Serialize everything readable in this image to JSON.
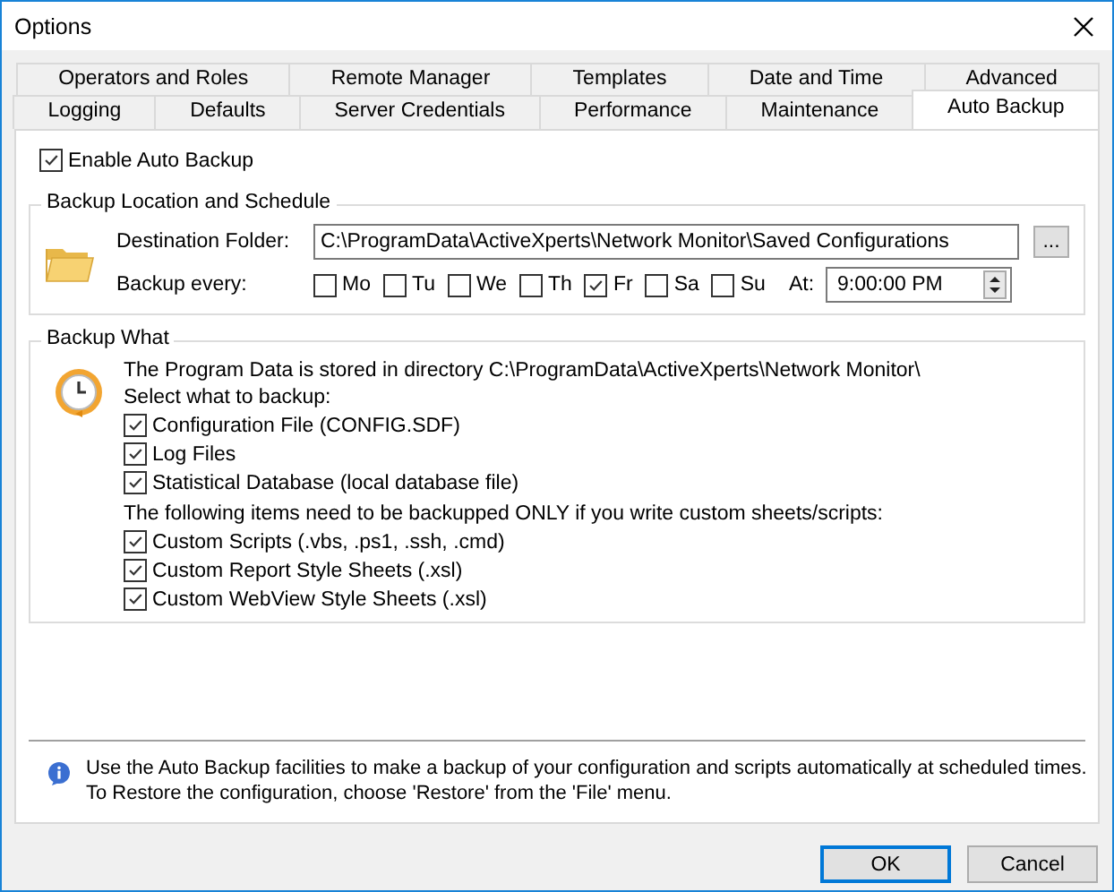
{
  "window": {
    "title": "Options"
  },
  "tab_rows": [
    [
      {
        "label": "Operators and Roles",
        "selected": false
      },
      {
        "label": "Remote Manager",
        "selected": false
      },
      {
        "label": "Templates",
        "selected": false
      },
      {
        "label": "Date and Time",
        "selected": false
      },
      {
        "label": "Advanced",
        "selected": false
      }
    ],
    [
      {
        "label": "Logging",
        "selected": false
      },
      {
        "label": "Defaults",
        "selected": false
      },
      {
        "label": "Server Credentials",
        "selected": false
      },
      {
        "label": "Performance",
        "selected": false
      },
      {
        "label": "Maintenance",
        "selected": false
      },
      {
        "label": "Auto Backup",
        "selected": true
      }
    ]
  ],
  "enable_auto_backup": {
    "label": "Enable Auto Backup",
    "checked": true
  },
  "location_group": {
    "title": "Backup Location and Schedule",
    "folder_label": "Destination Folder:",
    "folder_value": "C:\\ProgramData\\ActiveXperts\\Network Monitor\\Saved Configurations",
    "browse_button": "...",
    "every_label": "Backup every:",
    "days": [
      {
        "label": "Mo",
        "checked": false
      },
      {
        "label": "Tu",
        "checked": false
      },
      {
        "label": "We",
        "checked": false
      },
      {
        "label": "Th",
        "checked": false
      },
      {
        "label": "Fr",
        "checked": true
      },
      {
        "label": "Sa",
        "checked": false
      },
      {
        "label": "Su",
        "checked": false
      }
    ],
    "at_label": "At:",
    "time_value": "9:00:00 PM"
  },
  "what_group": {
    "title": "Backup What",
    "items": [
      {
        "kind": "text",
        "text": "The Program Data is stored in directory C:\\ProgramData\\ActiveXperts\\Network Monitor\\"
      },
      {
        "kind": "text",
        "text": "Select what to backup:"
      },
      {
        "kind": "checkbox",
        "text": "Configuration File (CONFIG.SDF)",
        "checked": true
      },
      {
        "kind": "checkbox",
        "text": "Log Files",
        "checked": true
      },
      {
        "kind": "checkbox",
        "text": "Statistical Database (local database file)",
        "checked": true
      },
      {
        "kind": "text",
        "text": "The following items need to be backupped ONLY if you write custom sheets/scripts:"
      },
      {
        "kind": "checkbox",
        "text": "Custom Scripts (.vbs, .ps1, .ssh, .cmd)",
        "checked": true
      },
      {
        "kind": "checkbox",
        "text": "Custom Report Style Sheets (.xsl)",
        "checked": true
      },
      {
        "kind": "checkbox",
        "text": "Custom WebView Style Sheets (.xsl)",
        "checked": true
      }
    ]
  },
  "info": [
    "Use the Auto Backup facilities to make a backup of your configuration and scripts automatically at scheduled times.",
    "To Restore the configuration, choose 'Restore' from the 'File' menu."
  ],
  "buttons": [
    {
      "label": "OK",
      "default": true
    },
    {
      "label": "Cancel",
      "default": false
    }
  ]
}
